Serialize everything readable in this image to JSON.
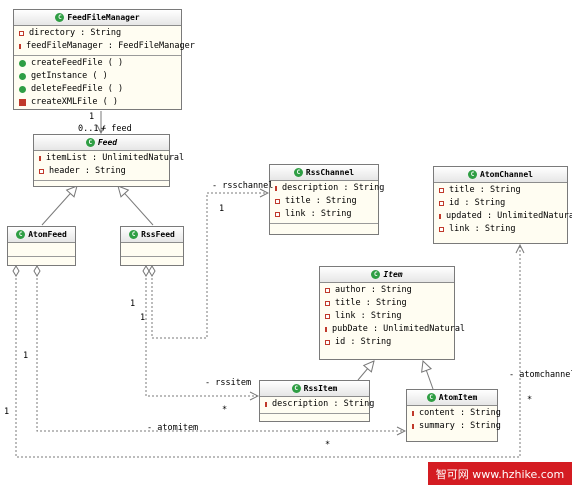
{
  "classes": {
    "feedfilemanager": {
      "name": "FeedFileManager",
      "attributes": [
        "directory : String",
        "feedFileManager : FeedFileManager"
      ],
      "methods": [
        "createFeedFile ( )",
        "getInstance ( )",
        "deleteFeedFile ( )",
        "createXMLFile ( )"
      ]
    },
    "feed": {
      "name": "Feed",
      "attributes": [
        "itemList : UnlimitedNatural",
        "header : String"
      ]
    },
    "rsschannel": {
      "name": "RssChannel",
      "attributes": [
        "description : String",
        "title : String",
        "link : String"
      ]
    },
    "atomchannel": {
      "name": "AtomChannel",
      "attributes": [
        "title : String",
        "id : String",
        "updated : UnlimitedNatural",
        "link : String"
      ]
    },
    "atomfeed": {
      "name": "AtomFeed"
    },
    "rssfeed": {
      "name": "RssFeed"
    },
    "item": {
      "name": "Item",
      "attributes": [
        "author : String",
        "title : String",
        "link : String",
        "pubDate : UnlimitedNatural",
        "id : String"
      ]
    },
    "rssitem": {
      "name": "RssItem",
      "attributes": [
        "description : String"
      ]
    },
    "atomitem": {
      "name": "AtomItem",
      "attributes": [
        "content : String",
        "summary : String"
      ]
    }
  },
  "labels": {
    "mult_1_top": "1",
    "mult_feed": "0..1",
    "role_feed": "+ feed",
    "role_rsschannel": "- rsschannel",
    "mult_rsschannel": "1",
    "mult_rssfeed_a": "1",
    "mult_rssfeed_b": "1",
    "mult_atomfeed": "1",
    "mult_left": "1",
    "role_rssitem": "- rssitem",
    "mult_rssitem_star": "*",
    "role_atomitem": "- atomitem",
    "mult_atomitem_star": "*",
    "role_atomchannel": "- atomchannel",
    "mult_atomchannel_star": "*"
  },
  "watermark": {
    "text": "智可网 www.hzhike.com"
  }
}
